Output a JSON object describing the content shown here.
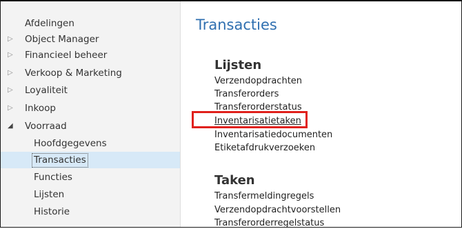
{
  "nav": {
    "items": [
      {
        "label": "Afdelingen",
        "expandable": false
      },
      {
        "label": "Object Manager",
        "expandable": true
      },
      {
        "label": "Financieel beheer",
        "expandable": true
      },
      {
        "label": "Verkoop & Marketing",
        "expandable": true
      },
      {
        "label": "Loyaliteit",
        "expandable": true
      },
      {
        "label": "Inkoop",
        "expandable": true
      },
      {
        "label": "Voorraad",
        "expandable": true,
        "expanded": true
      }
    ],
    "children": [
      {
        "label": "Hoofdgegevens"
      },
      {
        "label": "Transacties",
        "selected": true
      },
      {
        "label": "Functies"
      },
      {
        "label": "Lijsten"
      },
      {
        "label": "Historie"
      }
    ]
  },
  "main": {
    "title": "Transacties",
    "sections": [
      {
        "title": "Lijsten",
        "links": [
          "Verzendopdrachten",
          "Transferorders",
          "Transferorderstatus",
          "Inventarisatietaken",
          "Inventarisatiedocumenten",
          "Etiketafdrukverzoeken"
        ]
      },
      {
        "title": "Taken",
        "links": [
          "Transfermeldingregels",
          "Verzendopdrachtvoorstellen",
          "Transferorderregelstatus"
        ]
      }
    ]
  },
  "colors": {
    "highlight": "#e0201b",
    "title": "#2f6fb0",
    "selected_bg": "#d7e9f7"
  }
}
